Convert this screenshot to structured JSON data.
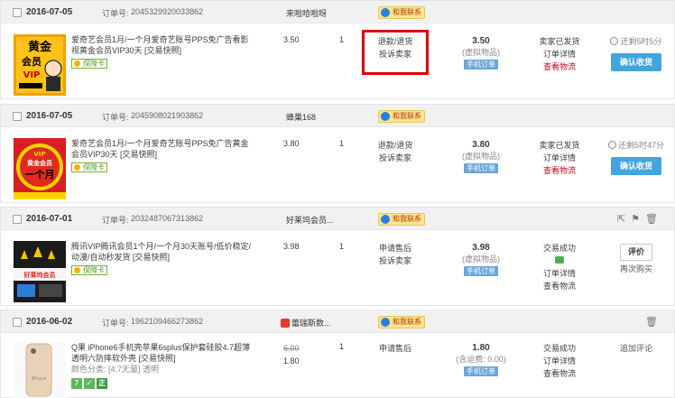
{
  "orders": [
    {
      "date": "2016-07-05",
      "order_no_label": "订单号:",
      "order_no": "2045329920033862",
      "shop": "来啦哈啦呀",
      "badge": "和我联系",
      "title": "爱奇艺会员1月/一个月爱奇艺账号PPS免广告看影视黄金会员VIP30天 [交易快照]",
      "tag": "保障卡",
      "price": "3.50",
      "qty": "1",
      "links": [
        "退款/退货",
        "投诉卖家"
      ],
      "total": "3.50",
      "total_note": "(虚拟物品)",
      "mobile": "手机订单",
      "status": [
        "卖家已发货",
        "订单详情",
        "查看物流"
      ],
      "remain": "还剩5时5分",
      "action": "确认收货"
    },
    {
      "date": "2016-07-05",
      "order_no_label": "订单号:",
      "order_no": "2045908021903862",
      "shop": "蜂巢168",
      "badge": "和我联系",
      "title": "爱奇艺会员1月/一个月爱奇艺账号PPS免广告黄金会员VIP30天 [交易快照]",
      "tag": "保障卡",
      "price": "3.80",
      "qty": "1",
      "links": [
        "退款/退货",
        "投诉卖家"
      ],
      "total": "3.80",
      "total_note": "(虚拟物品)",
      "mobile": "手机订单",
      "status": [
        "卖家已发货",
        "订单详情",
        "查看物流"
      ],
      "remain": "还剩5时47分",
      "action": "确认收货"
    },
    {
      "date": "2016-07-01",
      "order_no_label": "订单号:",
      "order_no": "2032487067313862",
      "shop": "好莱坞会员...",
      "badge": "和我联系",
      "title": "腾讯VIP腾讯会员1个月/一个月30天账号/低价稳定/动漫/自动秒发货 [交易快照]",
      "tag": "保障卡",
      "price": "3.98",
      "qty": "1",
      "links": [
        "申请售后",
        "投诉卖家"
      ],
      "total": "3.98",
      "total_note": "(虚拟物品)",
      "mobile": "手机订单",
      "status": [
        "交易成功",
        "订单详情",
        "查看物流"
      ],
      "action": "评价",
      "action2": "再次购买"
    },
    {
      "date": "2016-06-02",
      "order_no_label": "订单号:",
      "order_no": "1962109466273862",
      "shop": "蕾瑞斯数...",
      "badge": "和我联系",
      "title": "Q果 iPhone6手机壳苹果6splus保护套硅胶4.7超薄透明六防摔软外壳 [交易快照]",
      "variant": "颜色分类: [4.7无量] 透明",
      "price_old": "5.00",
      "price": "1.80",
      "qty": "1",
      "links": [
        "申请售后"
      ],
      "total": "1.80",
      "total_note": "(含运费: 0.00)",
      "mobile": "手机订单",
      "status": [
        "交易成功",
        "订单详情",
        "查看物流"
      ],
      "action": "追加评论"
    }
  ],
  "thumbs": {
    "t1_top": "黄金",
    "t1_mid": "会员",
    "t1_vip": "VIP",
    "t2_vip": "VIP",
    "t2_mid": "黄金会员",
    "t2_big": "一个月",
    "t3_text": "好莱坞会员",
    "t4_text": "iPhone"
  }
}
